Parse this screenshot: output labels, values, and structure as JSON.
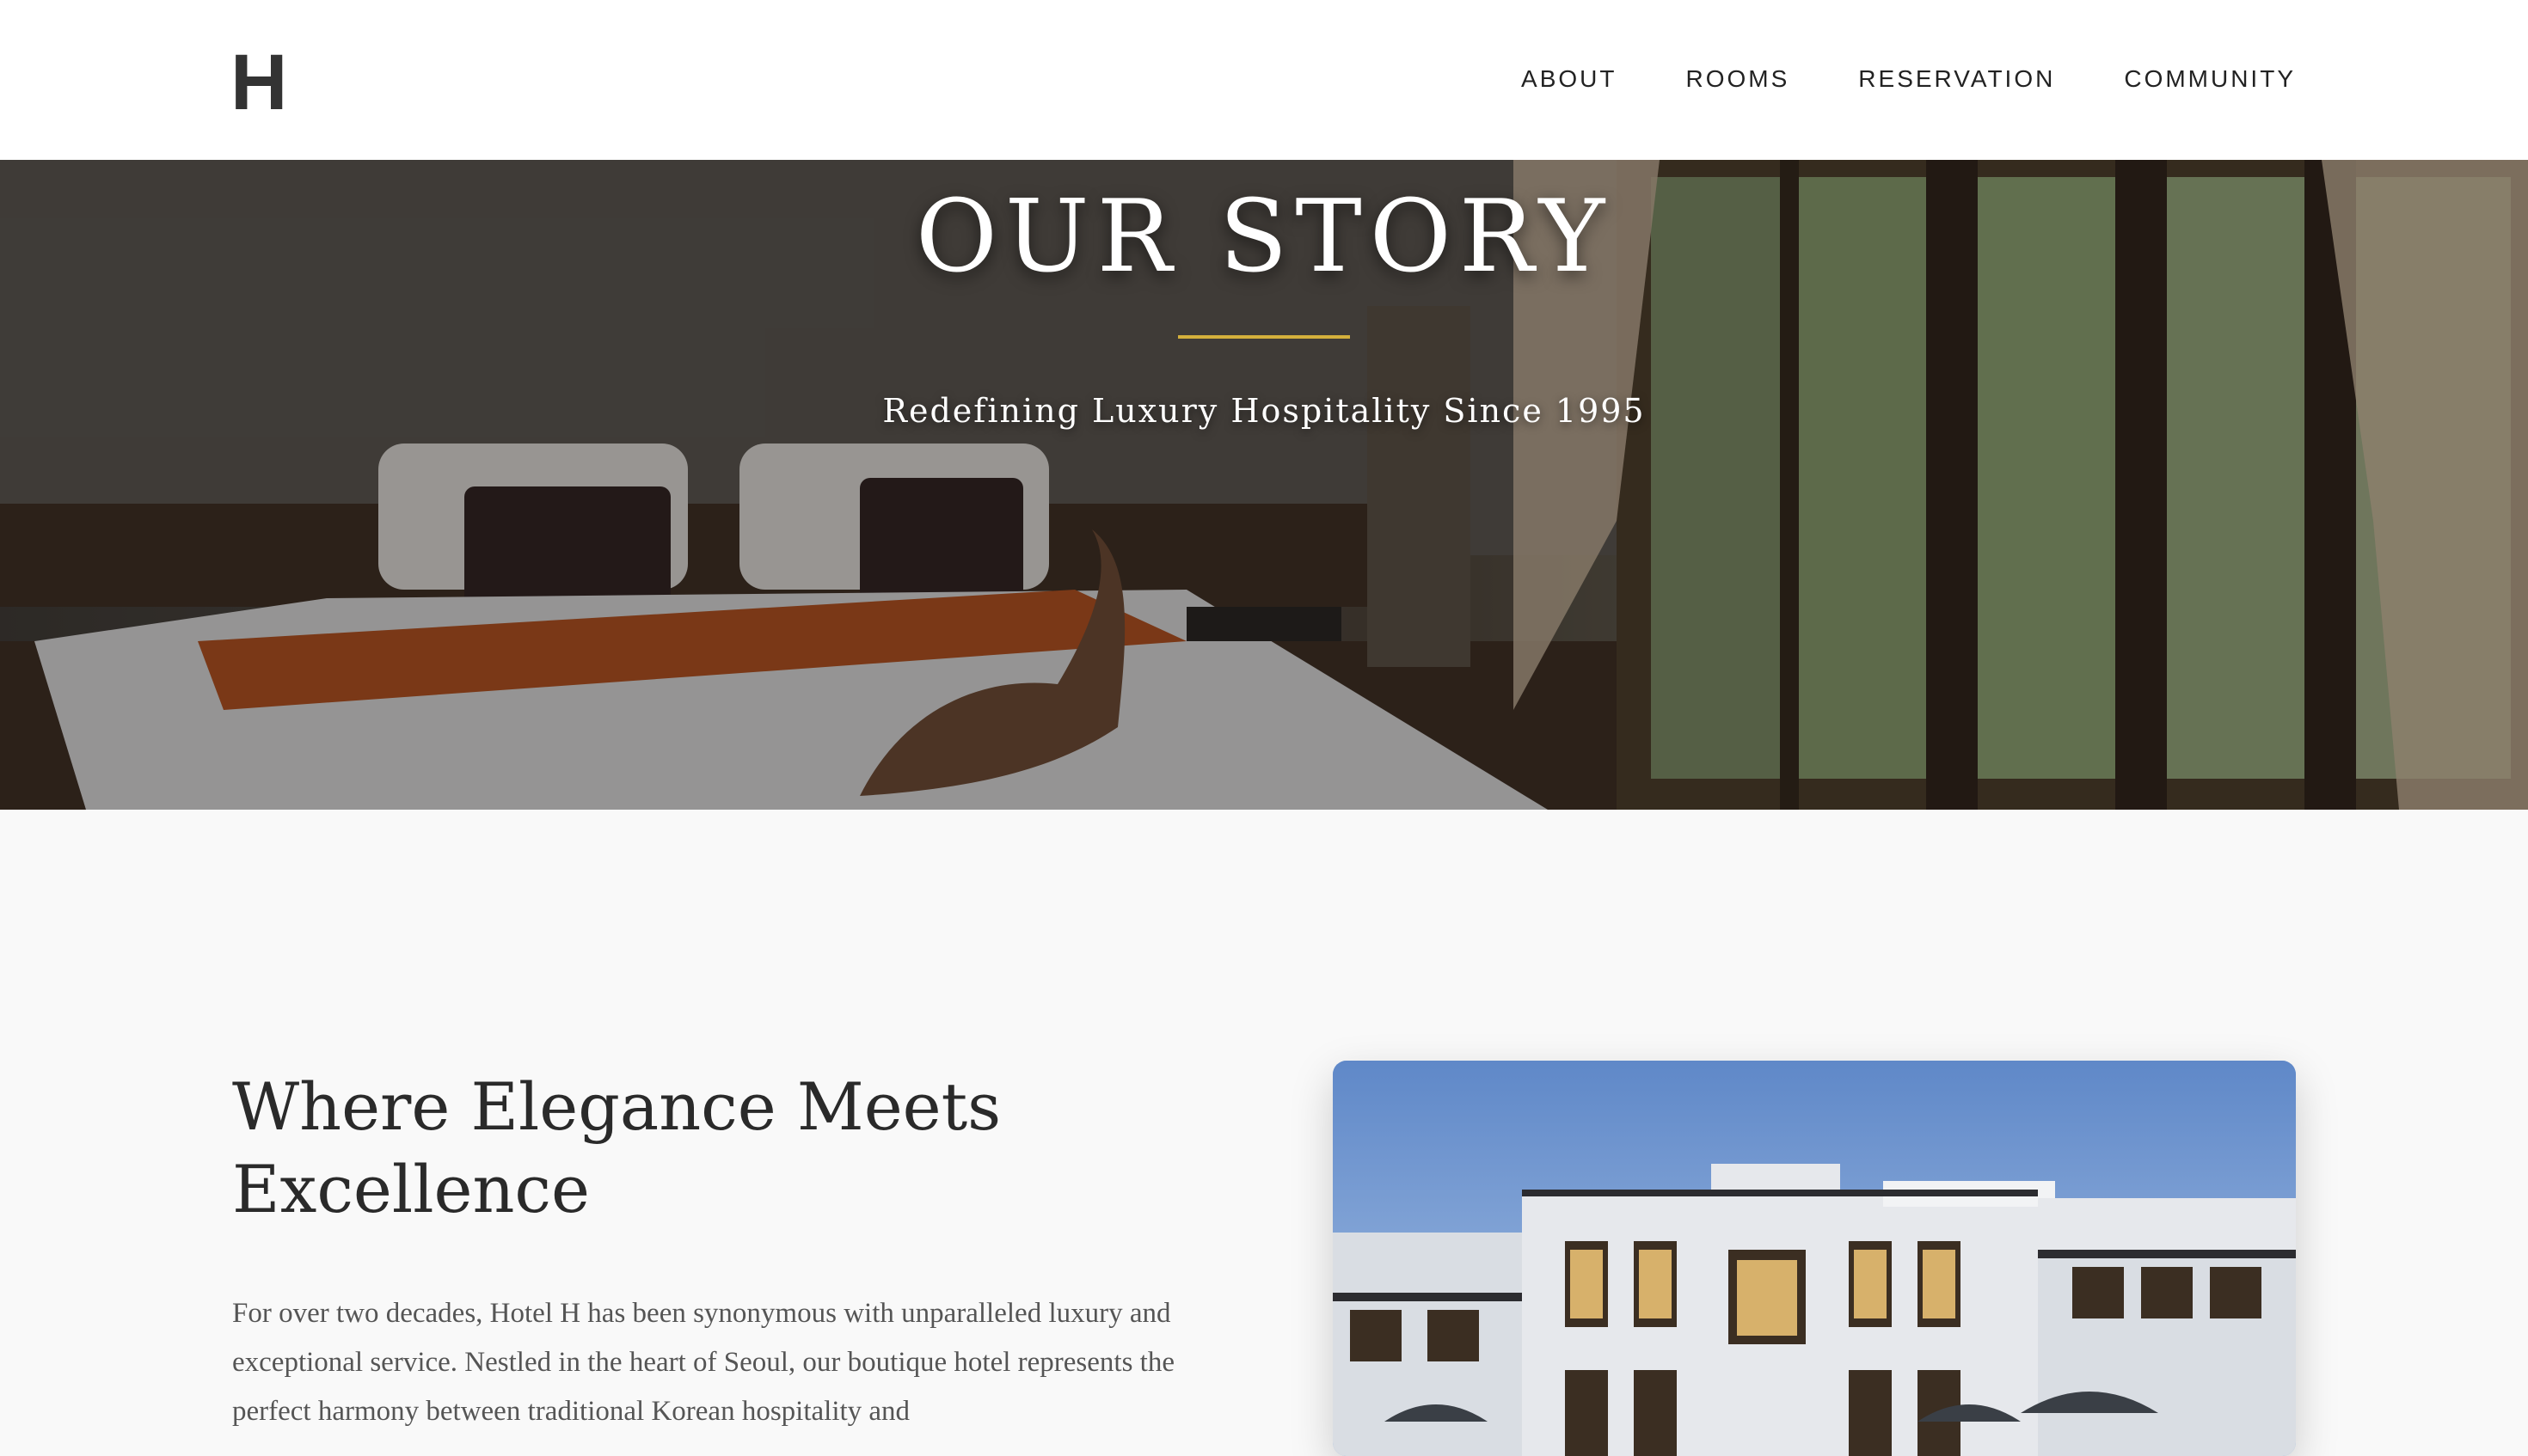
{
  "header": {
    "logo": "H",
    "nav": [
      {
        "label": "ABOUT"
      },
      {
        "label": "ROOMS"
      },
      {
        "label": "RESERVATION"
      },
      {
        "label": "COMMUNITY"
      }
    ]
  },
  "hero": {
    "title": "OUR STORY",
    "subtitle": "Redefining Luxury Hospitality Since 1995",
    "accent_color": "#d4b03c"
  },
  "main": {
    "heading": "Where Elegance Meets Excellence",
    "paragraph": "For over two decades, Hotel H has been synonymous with unparalleled luxury and exceptional service. Nestled in the heart of Seoul, our boutique hotel represents the perfect harmony between traditional Korean hospitality and"
  }
}
